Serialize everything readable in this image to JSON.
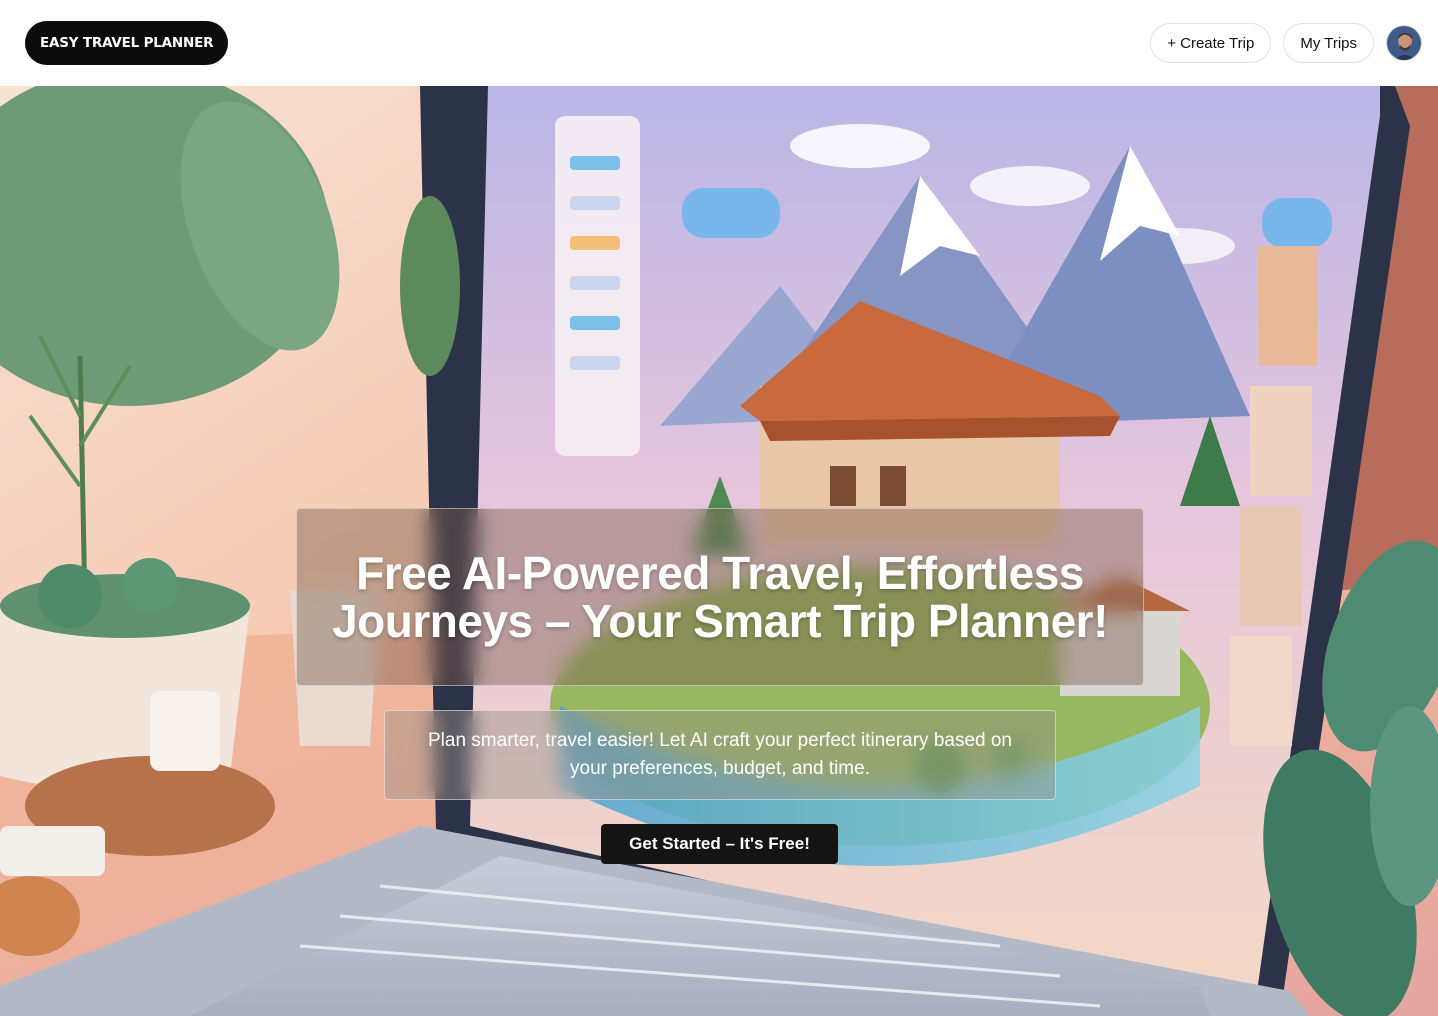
{
  "header": {
    "logo_text": "EASY TRAVEL PLANNER",
    "create_trip_label": "+ Create Trip",
    "my_trips_label": "My Trips",
    "avatar_icon": "user-avatar"
  },
  "hero": {
    "headline": "Free AI-Powered Travel, Effortless Journeys – Your Smart Trip Planner!",
    "subtitle": "Plan smarter, travel easier! Let AI craft your perfect itinerary based on your preferences, budget, and time.",
    "cta_label": "Get Started – It's Free!",
    "background_illustration": "laptop-travel-planner-illustration"
  },
  "colors": {
    "logo_bg": "#0c0c0c",
    "cta_bg": "#141414",
    "hero_wall": "#f4c4ab",
    "sky": "#c9b8e3",
    "roof": "#c86a3e",
    "water": "#67b8d8",
    "plant": "#5c8a5e"
  }
}
